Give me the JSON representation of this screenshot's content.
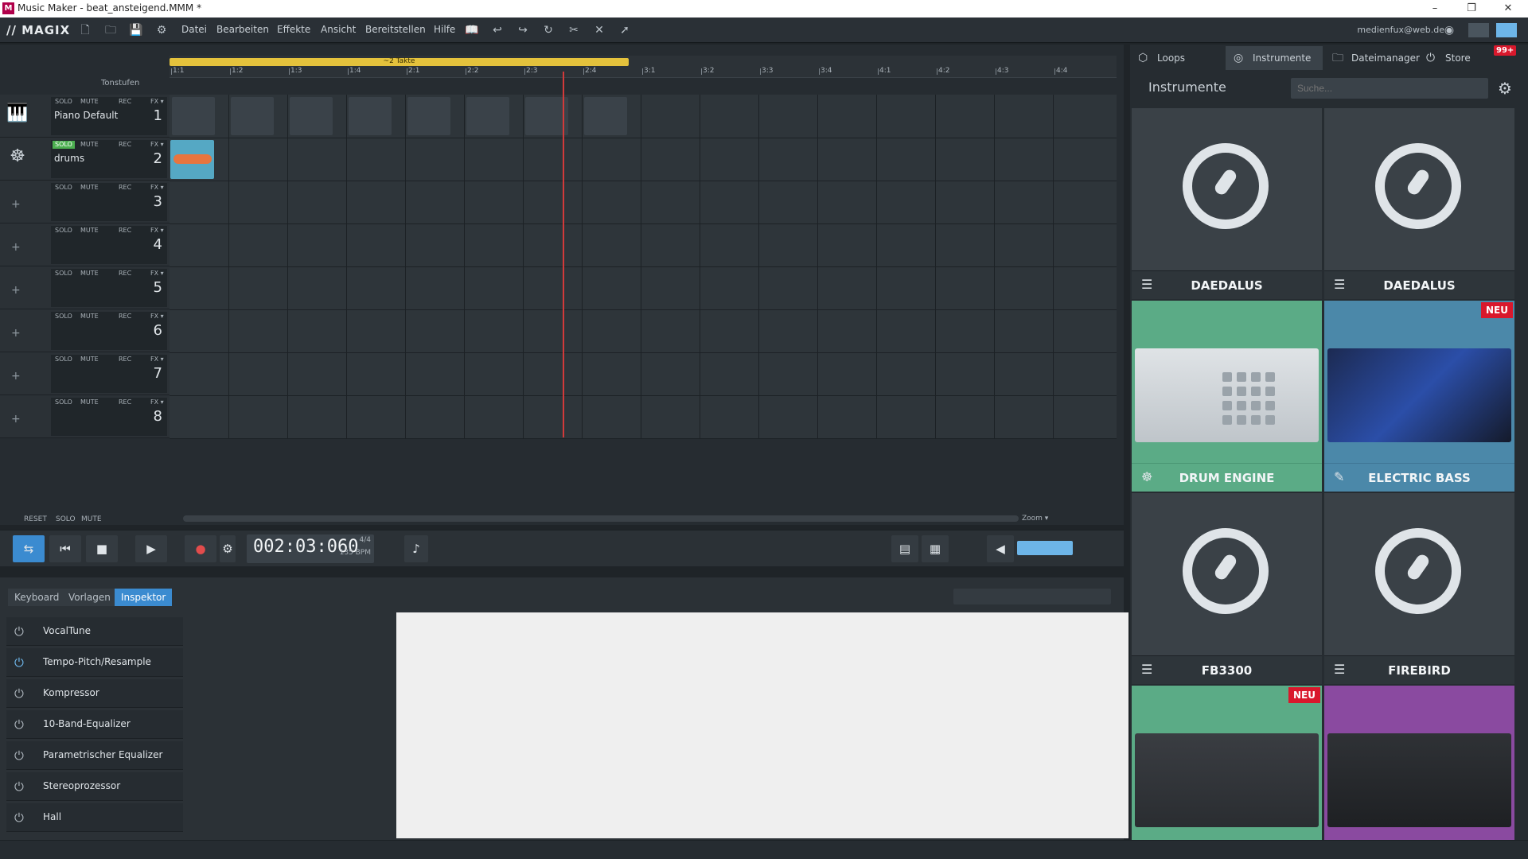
{
  "window": {
    "title": "Music Maker - beat_ansteigend.MMM *",
    "minimize": "–",
    "maximize": "❐",
    "close": "✕"
  },
  "menubar": {
    "logo": "// MAGIX",
    "items": [
      "Datei",
      "Bearbeiten",
      "Effekte",
      "Ansicht",
      "Bereitstellen",
      "Hilfe"
    ],
    "user": "medienfux@web.de"
  },
  "ruler": {
    "loop_label": "~2 Takte",
    "ticks": [
      "1:1",
      "1:2",
      "1:3",
      "1:4",
      "2:1",
      "2:2",
      "2:3",
      "2:4",
      "3:1",
      "3:2",
      "3:3",
      "3:4",
      "4:1",
      "4:2",
      "4:3",
      "4:4"
    ],
    "tonstufen": "Tonstufen"
  },
  "tracks": [
    {
      "name": "Piano Default",
      "num": "1",
      "icon": "piano-icon"
    },
    {
      "name": "drums",
      "num": "2",
      "icon": "drums-icon"
    },
    {
      "name": "",
      "num": "3",
      "icon": "plus-icon"
    },
    {
      "name": "",
      "num": "4",
      "icon": "plus-icon"
    },
    {
      "name": "",
      "num": "5",
      "icon": "plus-icon"
    },
    {
      "name": "",
      "num": "6",
      "icon": "plus-icon"
    },
    {
      "name": "",
      "num": "7",
      "icon": "plus-icon"
    },
    {
      "name": "",
      "num": "8",
      "icon": "plus-icon"
    }
  ],
  "track_buttons": {
    "solo": "SOLO",
    "mute": "MUTE",
    "rec": "REC",
    "fx": "FX ▾"
  },
  "arranger_footer": {
    "reset": "RESET",
    "solo": "SOLO",
    "mute": "MUTE",
    "zoom": "Zoom ▾"
  },
  "transport": {
    "time": "002:03:060",
    "signature": "4/4",
    "bpm": "135 BPM"
  },
  "bottom_tabs": [
    "Keyboard",
    "Vorlagen",
    "Inspektor"
  ],
  "effects": [
    {
      "name": "VocalTune",
      "on": false
    },
    {
      "name": "Tempo-Pitch/Resample",
      "on": true
    },
    {
      "name": "Kompressor",
      "on": false
    },
    {
      "name": "10-Band-Equalizer",
      "on": false
    },
    {
      "name": "Parametrischer Equalizer",
      "on": false
    },
    {
      "name": "Stereoprozessor",
      "on": false
    },
    {
      "name": "Hall",
      "on": false
    }
  ],
  "sidebar": {
    "tabs": [
      "Loops",
      "Instrumente",
      "Dateimanager",
      "Store"
    ],
    "store_badge": "99+",
    "title": "Instrumente",
    "search_placeholder": "Suche...",
    "instruments": [
      {
        "name": "DAEDALUS",
        "style": "gray"
      },
      {
        "name": "DAEDALUS",
        "style": "gray"
      },
      {
        "name": "DRUM ENGINE",
        "style": "green"
      },
      {
        "name": "ELECTRIC BASS",
        "style": "blue",
        "badge": "NEU"
      },
      {
        "name": "FB3300",
        "style": "gray"
      },
      {
        "name": "FIREBIRD",
        "style": "gray"
      },
      {
        "name": "",
        "style": "green",
        "badge": "NEU"
      },
      {
        "name": "",
        "style": "purple"
      }
    ]
  },
  "colors": {
    "accent": "#3b8bd0",
    "solo_on": "#4caf50",
    "playhead": "#d23a3a",
    "badge": "#d9182c"
  }
}
